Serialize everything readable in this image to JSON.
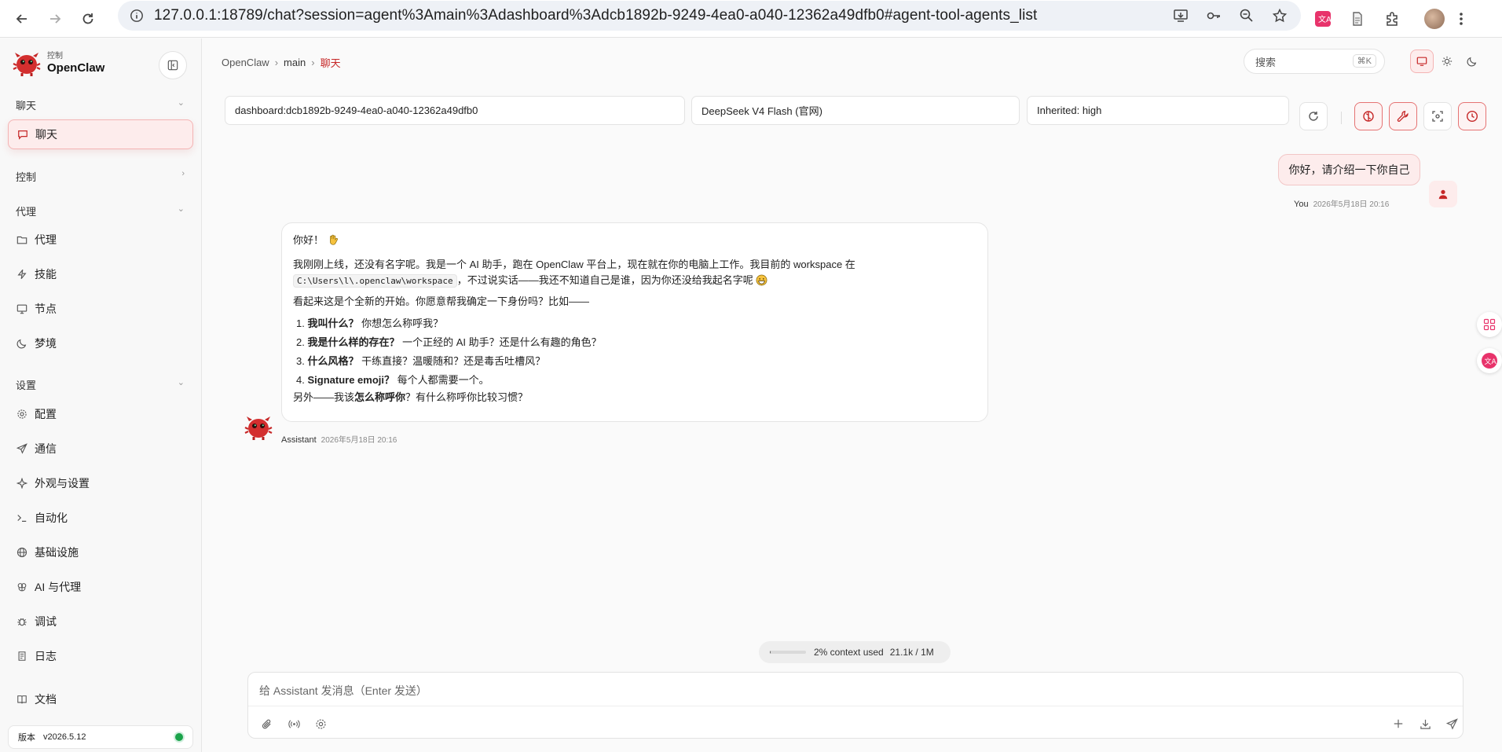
{
  "browser": {
    "url": "127.0.0.1:18789/chat?session=agent%3Amain%3Adashboard%3Adcb1892b-9249-4ea0-a040-12362a49dfb0#agent-tool-agents_list"
  },
  "brand": {
    "subtitle": "控制",
    "name": "OpenClaw"
  },
  "sidebar": {
    "chat_section": "聊天",
    "chat_item": "聊天",
    "control_section": "控制",
    "agent_section": "代理",
    "agent_items": [
      "代理",
      "技能",
      "节点",
      "梦境"
    ],
    "settings_section": "设置",
    "settings_items": [
      "配置",
      "通信",
      "外观与设置",
      "自动化",
      "基础设施",
      "AI 与代理",
      "调试",
      "日志"
    ],
    "docs": "文档",
    "version_label": "版本",
    "version": "v2026.5.12",
    "status_color": "#1aa34a"
  },
  "breadcrumb": {
    "root": "OpenClaw",
    "middle": "main",
    "current": "聊天"
  },
  "search": {
    "placeholder": "搜索",
    "shortcut": "⌘K"
  },
  "session": {
    "session_key": "dashboard:dcb1892b-9249-4ea0-a040-12362a49dfb0",
    "model": "DeepSeek V4 Flash (官网)",
    "thinking": "Inherited: high"
  },
  "messages": {
    "user": {
      "text": "你好，请介绍一下你自己",
      "sender": "You",
      "time": "2026年5月18日 20:16"
    },
    "assistant": {
      "greeting": "你好！",
      "para1_a": "我刚刚上线，还没有名字呢。我是一个 AI 助手，跑在 OpenClaw 平台上，现在就在你的电脑上工作。我目前的 workspace 在",
      "workspace_path": "C:\\Users\\l\\.openclaw\\workspace",
      "para1_b": "，不过说实话——我还不知道自己是谁，因为你还没给我起名字呢",
      "para2": "看起来这是个全新的开始。你愿意帮我确定一下身份吗？比如——",
      "list": [
        {
          "num": "1.",
          "bold": "我叫什么？",
          "text": "你想怎么称呼我？"
        },
        {
          "num": "2.",
          "bold": "我是什么样的存在？",
          "text": "一个正经的 AI 助手？还是什么有趣的角色？"
        },
        {
          "num": "3.",
          "bold": "什么风格？",
          "text": "干练直接？温暖随和？还是毒舌吐槽风？"
        },
        {
          "num": "4.",
          "bold": "Signature emoji？",
          "text": "每个人都需要一个。"
        }
      ],
      "closing_a": "另外——我该",
      "closing_bold": "怎么称呼你",
      "closing_b": "？有什么称呼你比较习惯？",
      "sender": "Assistant",
      "time": "2026年5月18日 20:16"
    }
  },
  "context": {
    "percent_text": "2% context used",
    "fraction": 0.02,
    "usage": "21.1k / 1M"
  },
  "composer": {
    "placeholder": "给 Assistant 发消息（Enter 发送）"
  },
  "colors": {
    "accent": "#c62828",
    "accent_bg": "#fdecec"
  }
}
